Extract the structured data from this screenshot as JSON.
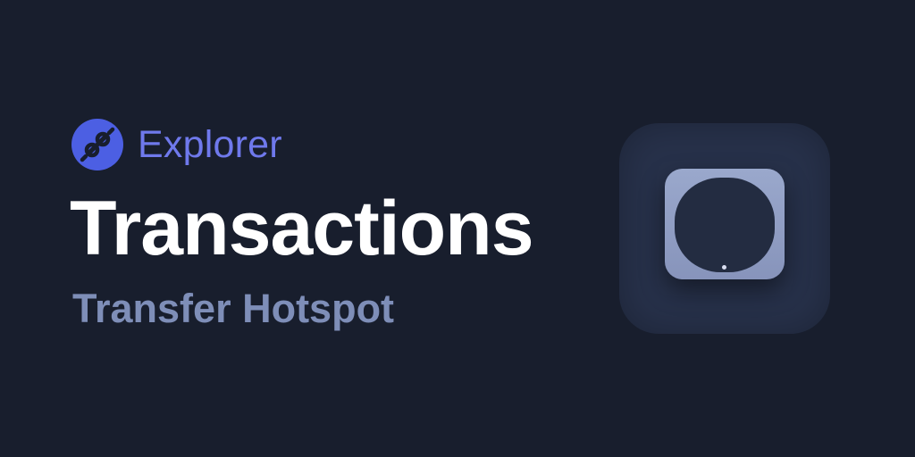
{
  "brand": {
    "name": "Explorer",
    "logo_icon": "helium-logo-icon",
    "logo_color": "#4c5fe3"
  },
  "header": {
    "title": "Transactions",
    "subtitle": "Transfer Hotspot"
  },
  "illustration": {
    "icon": "hotspot-device-icon"
  },
  "colors": {
    "background": "#181e2d",
    "brand_text": "#6f79ec",
    "title_text": "#ffffff",
    "subtitle_text": "#7e8eb8",
    "tile": "#27314a",
    "device": "#8f9cc4"
  }
}
